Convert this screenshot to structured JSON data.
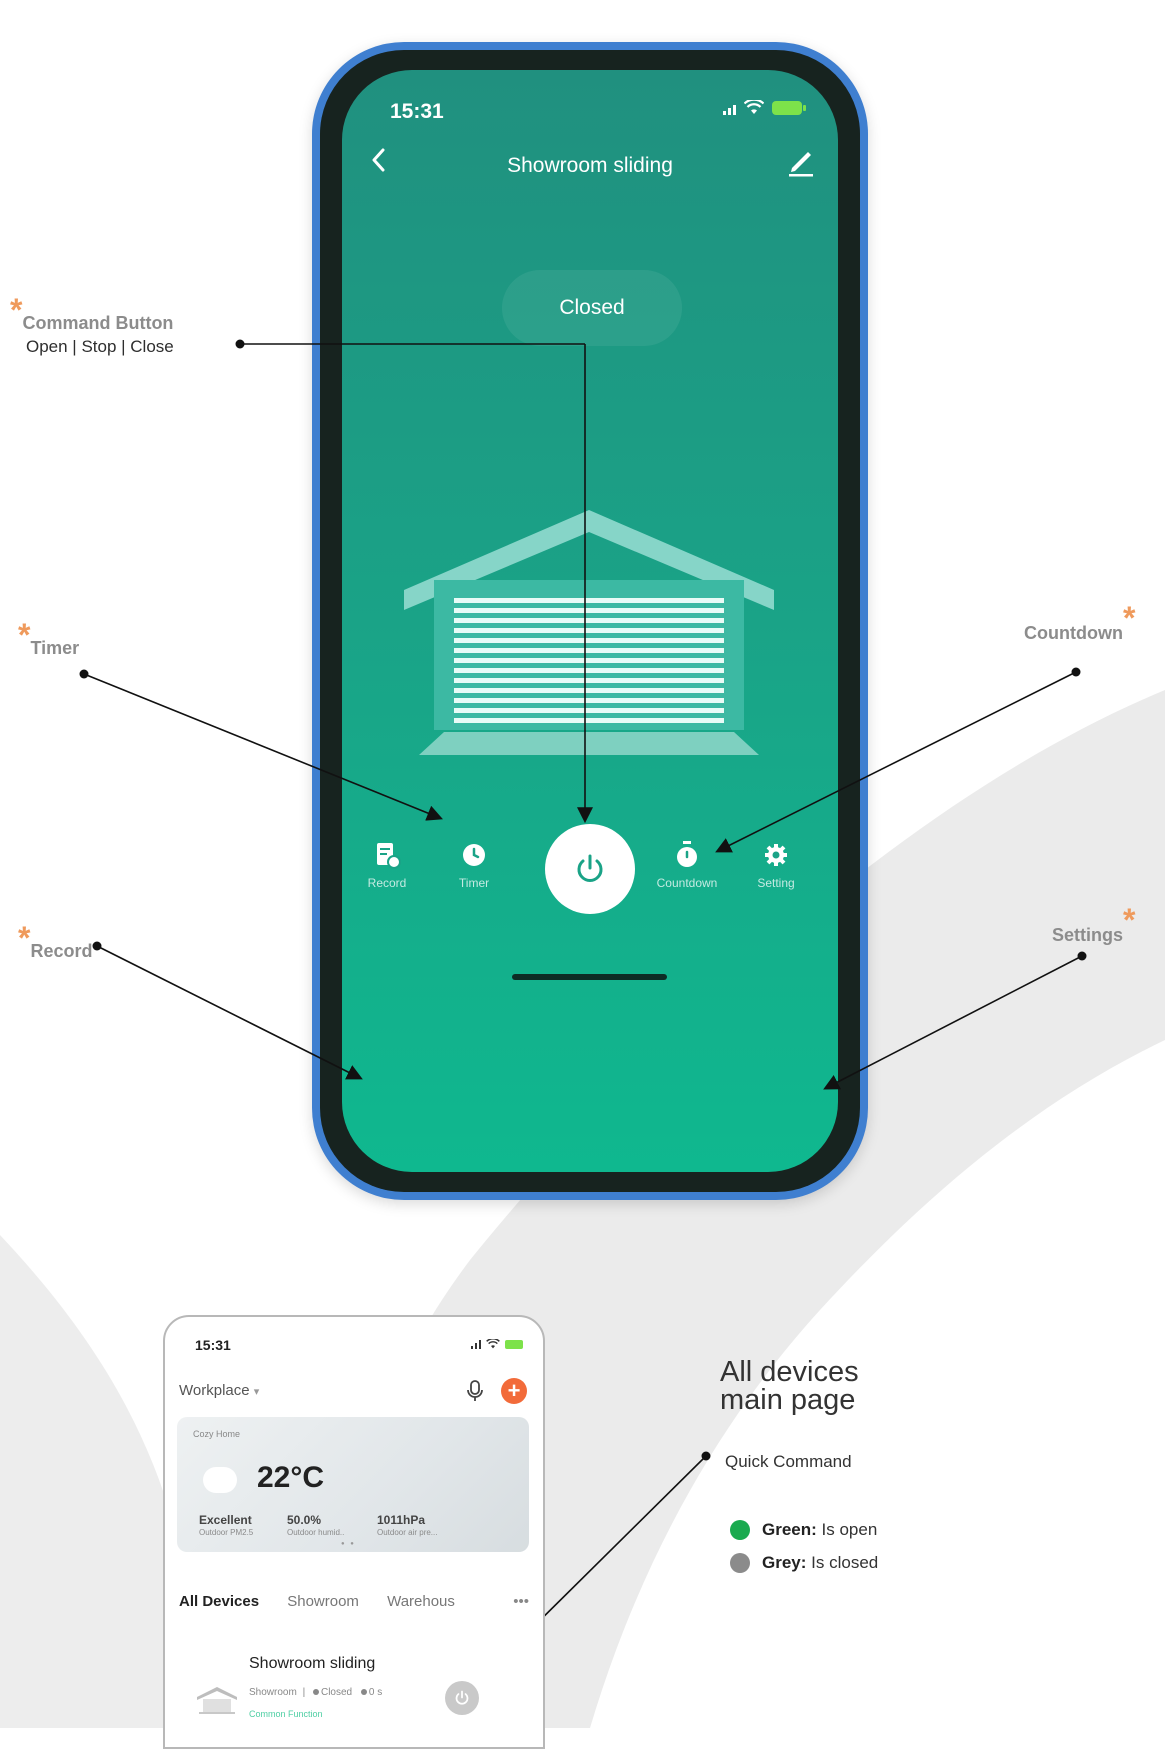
{
  "phone": {
    "status_time": "15:31",
    "title": "Showroom sliding",
    "door_status": "Closed",
    "tabs": {
      "record": "Record",
      "timer": "Timer",
      "countdown": "Countdown",
      "setting": "Setting"
    }
  },
  "callouts": {
    "command": {
      "title": "Command Button",
      "sub": "Open | Stop | Close"
    },
    "timer": "Timer",
    "record": "Record",
    "countdown": "Countdown",
    "settings": "Settings",
    "star": "*"
  },
  "mini": {
    "status_time": "15:31",
    "home_name": "Workplace",
    "add_symbol": "+",
    "weather": {
      "location": "Cozy Home",
      "temperature": "22°C",
      "stats": [
        {
          "value": "Excellent",
          "label": "Outdoor PM2.5"
        },
        {
          "value": "50.0%",
          "label": "Outdoor humid.."
        },
        {
          "value": "1011hPa",
          "label": "Outdoor air pre..."
        }
      ]
    },
    "tabs": [
      "All Devices",
      "Showroom",
      "Warehous"
    ],
    "tabs_more": "•••",
    "device": {
      "name": "Showroom sliding",
      "room": "Showroom",
      "separator": "|",
      "state": "Closed",
      "time": "0 s",
      "function": "Common Function"
    }
  },
  "legend": {
    "title_line1": "All devices",
    "title_line2": "main page",
    "quick_command": "Quick Command",
    "items": [
      {
        "label": "Green:",
        "text": "Is open",
        "color": "#1aaa4f"
      },
      {
        "label": "Grey:",
        "text": "Is closed",
        "color": "#8b8b8b"
      }
    ]
  },
  "colors": {
    "accent_star": "#ef9a5c",
    "screen_top": "#20907f",
    "screen_bottom": "#0fb88f",
    "phone_frame": "#3f7fd0"
  }
}
